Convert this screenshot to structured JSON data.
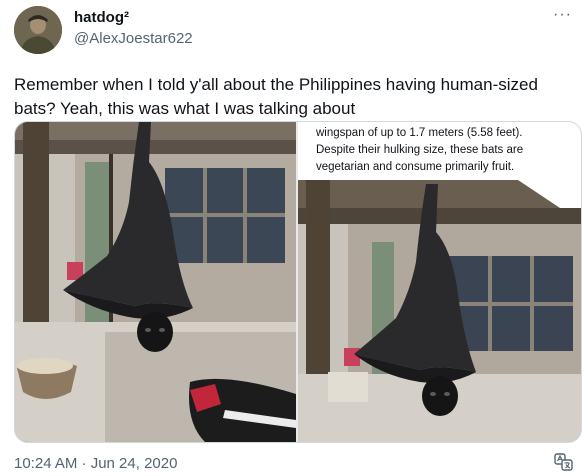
{
  "author": {
    "display_name": "hatdog²",
    "handle": "@AlexJoestar622"
  },
  "tweet": {
    "text": "Remember when I told y'all about the Philippines having human-sized\nbats? Yeah, this was what I was talking about",
    "timestamp": "10:24 AM · Jun 24, 2020"
  },
  "menu": {
    "more_label": "···"
  },
  "media": {
    "caption_lines": [
      "wingspan of up to 1.7 meters (5.58 feet).",
      "Despite their hulking size, these bats are",
      "vegetarian and consume primarily fruit."
    ]
  },
  "icons": {
    "more": "more-dots-icon",
    "translate": "translate-icon"
  },
  "colors": {
    "text_primary": "#0f1419",
    "text_secondary": "#536471",
    "border": "#cfd9de"
  }
}
